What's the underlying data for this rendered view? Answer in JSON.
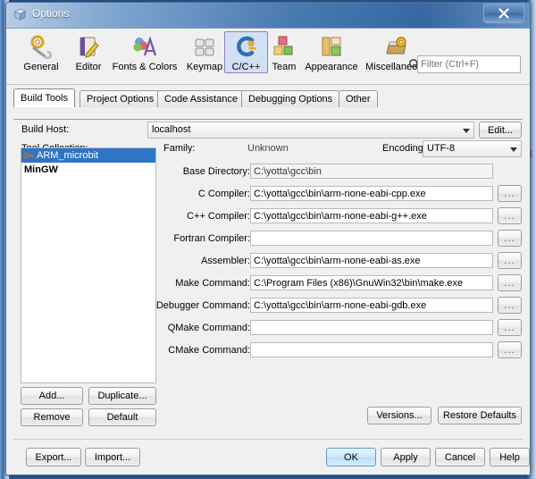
{
  "window": {
    "title": "Options",
    "title_icon": "cube-icon",
    "close_label": "x"
  },
  "toolbar": {
    "search_icon": "search-icon",
    "filter_placeholder": "Filter (Ctrl+F)",
    "filter_value": "",
    "selected": "C/C++",
    "items": [
      {
        "label": "General",
        "icon": "gear-wrench-icon"
      },
      {
        "label": "Editor",
        "icon": "book-pencil-icon"
      },
      {
        "label": "Fonts & Colors",
        "icon": "fonts-colors-icon"
      },
      {
        "label": "Keymap",
        "icon": "keyboard-icon"
      },
      {
        "label": "C/C++",
        "icon": "cpp-icon"
      },
      {
        "label": "Team",
        "icon": "team-boxes-icon"
      },
      {
        "label": "Appearance",
        "icon": "appearance-panels-icon"
      },
      {
        "label": "Miscellaneous",
        "icon": "misc-gear-folder-icon"
      }
    ]
  },
  "tabs": [
    {
      "label": "Build Tools",
      "active": true
    },
    {
      "label": "Project Options",
      "active": false
    },
    {
      "label": "Code Assistance",
      "active": false
    },
    {
      "label": "Debugging Options",
      "active": false
    },
    {
      "label": "Other",
      "active": false
    }
  ],
  "build_host": {
    "label": "Build Host:",
    "value": "localhost",
    "edit_button": "Edit..."
  },
  "tool_collection": {
    "label": "Tool Collection:",
    "items": [
      {
        "name": "ARM_microbit",
        "selected": true,
        "bold": false,
        "icon": "key-icon"
      },
      {
        "name": "MinGW",
        "selected": false,
        "bold": true,
        "icon": ""
      }
    ],
    "buttons": [
      "Add...",
      "Duplicate...",
      "Remove",
      "Default"
    ]
  },
  "details": {
    "family_label": "Family:",
    "family_value": "Unknown",
    "encoding_label": "Encoding:",
    "encoding_value": "UTF-8",
    "browse_button": "...",
    "fields": [
      {
        "label": "Base Directory:",
        "value": "C:\\yotta\\gcc\\bin",
        "readonly": true,
        "browse": false
      },
      {
        "label": "C Compiler:",
        "value": "C:\\yotta\\gcc\\bin\\arm-none-eabi-cpp.exe",
        "readonly": false,
        "browse": true
      },
      {
        "label": "C++ Compiler:",
        "value": "C:\\yotta\\gcc\\bin\\arm-none-eabi-g++.exe",
        "readonly": false,
        "browse": true
      },
      {
        "label": "Fortran Compiler:",
        "value": "",
        "readonly": false,
        "browse": true
      },
      {
        "label": "Assembler:",
        "value": "C:\\yotta\\gcc\\bin\\arm-none-eabi-as.exe",
        "readonly": false,
        "browse": true
      },
      {
        "label": "Make Command:",
        "value": "C:\\Program Files (x86)\\GnuWin32\\bin\\make.exe",
        "readonly": false,
        "browse": true
      },
      {
        "label": "Debugger Command:",
        "value": "C:\\yotta\\gcc\\bin\\arm-none-eabi-gdb.exe",
        "readonly": false,
        "browse": true
      },
      {
        "label": "QMake Command:",
        "value": "",
        "readonly": false,
        "browse": true
      },
      {
        "label": "CMake Command:",
        "value": "",
        "readonly": false,
        "browse": true
      }
    ],
    "versions_button": "Versions...",
    "restore_defaults_button": "Restore Defaults"
  },
  "footer": {
    "export_button": "Export...",
    "import_button": "Import...",
    "ok_button": "OK",
    "apply_button": "Apply",
    "cancel_button": "Cancel",
    "help_button": "Help"
  },
  "colors": {
    "selection_blue": "#2e75c6",
    "default_button_blue": "#b9ddf8",
    "tab_highlight": "#d2e0f4",
    "dialog_bg": "#f0f0f0"
  }
}
